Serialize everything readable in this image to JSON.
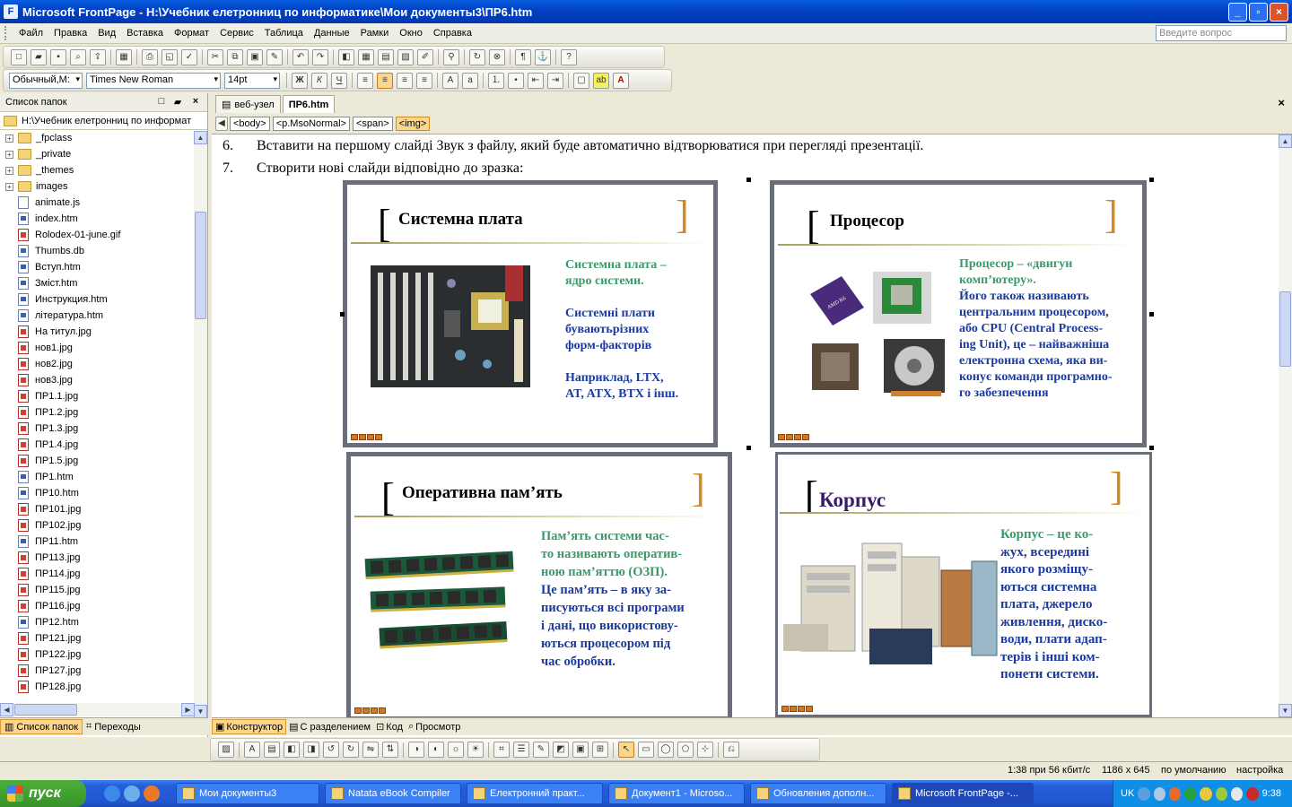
{
  "window": {
    "title": "Microsoft FrontPage - H:\\Учебник елетронниц по информатике\\Мои документы3\\ПР6.htm"
  },
  "menu": [
    "Файл",
    "Правка",
    "Вид",
    "Вставка",
    "Формат",
    "Сервис",
    "Таблица",
    "Данные",
    "Рамки",
    "Окно",
    "Справка"
  ],
  "ask_placeholder": "Введите вопрос",
  "format_bar": {
    "style": "Обычный,М:",
    "font": "Times New Roman",
    "size": "14pt"
  },
  "folder_pane": {
    "title": "Список папок",
    "root": "H:\\Учебник елетронниц по информат",
    "folders": [
      "_fpclass",
      "_private",
      "_themes",
      "images"
    ],
    "files": [
      {
        "name": "animate.js",
        "type": "js"
      },
      {
        "name": "index.htm",
        "type": "htm"
      },
      {
        "name": "Rolodex-01-june.gif",
        "type": "jpg"
      },
      {
        "name": "Thumbs.db",
        "type": "htm"
      },
      {
        "name": "Вступ.htm",
        "type": "htm"
      },
      {
        "name": "Зміст.htm",
        "type": "htm"
      },
      {
        "name": "Инструкция.htm",
        "type": "htm"
      },
      {
        "name": "література.htm",
        "type": "htm"
      },
      {
        "name": "На титул.jpg",
        "type": "jpg"
      },
      {
        "name": "нов1.jpg",
        "type": "jpg"
      },
      {
        "name": "нов2.jpg",
        "type": "jpg"
      },
      {
        "name": "нов3.jpg",
        "type": "jpg"
      },
      {
        "name": "ПР1.1.jpg",
        "type": "jpg"
      },
      {
        "name": "ПР1.2.jpg",
        "type": "jpg"
      },
      {
        "name": "ПР1.3.jpg",
        "type": "jpg"
      },
      {
        "name": "ПР1.4.jpg",
        "type": "jpg"
      },
      {
        "name": "ПР1.5.jpg",
        "type": "jpg"
      },
      {
        "name": "ПР1.htm",
        "type": "htm"
      },
      {
        "name": "ПР10.htm",
        "type": "htm"
      },
      {
        "name": "ПР101.jpg",
        "type": "jpg"
      },
      {
        "name": "ПР102.jpg",
        "type": "jpg"
      },
      {
        "name": "ПР11.htm",
        "type": "htm"
      },
      {
        "name": "ПР113.jpg",
        "type": "jpg"
      },
      {
        "name": "ПР114.jpg",
        "type": "jpg"
      },
      {
        "name": "ПР115.jpg",
        "type": "jpg"
      },
      {
        "name": "ПР116.jpg",
        "type": "jpg"
      },
      {
        "name": "ПР12.htm",
        "type": "htm"
      },
      {
        "name": "ПР121.jpg",
        "type": "jpg"
      },
      {
        "name": "ПР122.jpg",
        "type": "jpg"
      },
      {
        "name": "ПР127.jpg",
        "type": "jpg"
      },
      {
        "name": "ПР128.jpg",
        "type": "jpg"
      }
    ],
    "tab_folders": "Список папок",
    "tab_nav": "Переходы"
  },
  "doc_tabs": [
    "веб-узел",
    "ПР6.htm"
  ],
  "tags": [
    "<body>",
    "<p.MsoNormal>",
    "<span>",
    "<img>"
  ],
  "paragraphs": [
    {
      "num": "6.",
      "text": "Вставити на першому слайді Звук з файлу, який буде автоматично відтворюватися при перегляді презентації."
    },
    {
      "num": "7.",
      "text": "Створити нові слайди відповідно до зразка:"
    }
  ],
  "slides": {
    "s1": {
      "title": "Системна плата",
      "lines": [
        {
          "t": "Системна плата –",
          "g": true
        },
        {
          "t": "ядро системи.",
          "g": true
        },
        {
          "t": "",
          "g": false
        },
        {
          "t": "Системні плати",
          "g": false
        },
        {
          "t": "буваютьрізних",
          "g": false
        },
        {
          "t": "форм-факторів",
          "g": false
        },
        {
          "t": "",
          "g": false
        },
        {
          "t": "Наприклад, LTX,",
          "g": false
        },
        {
          "t": "AT, ATX, BTX і інш.",
          "g": false
        }
      ]
    },
    "s2": {
      "title": "Процесор",
      "lines": [
        {
          "t": "Процесор – «двигун",
          "g": true
        },
        {
          "t": "комп’ютеру».",
          "g": true
        },
        {
          "t": "Його також називають",
          "g": false
        },
        {
          "t": "центральним процесором,",
          "g": false
        },
        {
          "t": "або CPU (Central Process-",
          "g": false
        },
        {
          "t": "ing Unit), це – найважніша",
          "g": false
        },
        {
          "t": "електронна схема, яка ви-",
          "g": false
        },
        {
          "t": "конує команди програмно-",
          "g": false
        },
        {
          "t": "го забезпечення",
          "g": false
        }
      ]
    },
    "s3": {
      "title": "Оперативна пам’ять",
      "lines": [
        {
          "t": "Пам’ять системи час-",
          "g": true
        },
        {
          "t": "то називають оператив-",
          "g": true
        },
        {
          "t": "ною пам’яттю (ОЗП).",
          "g": true
        },
        {
          "t": "Це пам’ять – в яку за-",
          "g": false
        },
        {
          "t": "писуються всі програми",
          "g": false
        },
        {
          "t": "і дані, що використову-",
          "g": false
        },
        {
          "t": "ються процесором під",
          "g": false
        },
        {
          "t": "час обробки.",
          "g": false
        }
      ]
    },
    "s4": {
      "title": "Корпус",
      "lines": [
        {
          "t": "Корпус – це ко-",
          "g": true
        },
        {
          "t": "жух, всередині",
          "g": false
        },
        {
          "t": "якого розміщу-",
          "g": false
        },
        {
          "t": "ються системна",
          "g": false
        },
        {
          "t": "плата, джерело",
          "g": false
        },
        {
          "t": "живлення, диско-",
          "g": false
        },
        {
          "t": "води, плати адап-",
          "g": false
        },
        {
          "t": "терів і інші ком-",
          "g": false
        },
        {
          "t": "понети системи.",
          "g": false
        }
      ]
    }
  },
  "view_tabs": [
    "Конструктор",
    "С разделением",
    "Код",
    "Просмотр"
  ],
  "status": {
    "speed": "1:38 при 56 кбит/с",
    "size": "1186 x 645",
    "mode": "по умолчанию",
    "custom": "настройка"
  },
  "taskbar": {
    "start": "пуск",
    "tasks": [
      "Мои документы3",
      "Natata eBook Compiler",
      "Електронний практ...",
      "Документ1 - Microso...",
      "Обновления дополн...",
      "Microsoft FrontPage -..."
    ],
    "lang": "UK",
    "clock": "9:38"
  }
}
